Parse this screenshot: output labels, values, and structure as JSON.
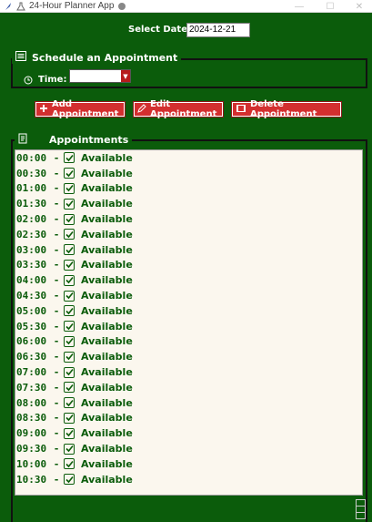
{
  "window": {
    "title": "24-Hour Planner App"
  },
  "date": {
    "label": "Select Date:",
    "value": "2024-12-21"
  },
  "schedule": {
    "title": "Schedule an Appointment",
    "time_label": "Time:",
    "time_value": ""
  },
  "buttons": {
    "add": "Add Appointment",
    "edit": "Edit Appointment",
    "delete": "Delete Appointment"
  },
  "appointments": {
    "title": "Appointments",
    "rows": [
      {
        "time": "00:00",
        "sep": "-",
        "status": "Available"
      },
      {
        "time": "00:30",
        "sep": "-",
        "status": "Available"
      },
      {
        "time": "01:00",
        "sep": "-",
        "status": "Available"
      },
      {
        "time": "01:30",
        "sep": "-",
        "status": "Available"
      },
      {
        "time": "02:00",
        "sep": "-",
        "status": "Available"
      },
      {
        "time": "02:30",
        "sep": "-",
        "status": "Available"
      },
      {
        "time": "03:00",
        "sep": "-",
        "status": "Available"
      },
      {
        "time": "03:30",
        "sep": "-",
        "status": "Available"
      },
      {
        "time": "04:00",
        "sep": "-",
        "status": "Available"
      },
      {
        "time": "04:30",
        "sep": "-",
        "status": "Available"
      },
      {
        "time": "05:00",
        "sep": "-",
        "status": "Available"
      },
      {
        "time": "05:30",
        "sep": "-",
        "status": "Available"
      },
      {
        "time": "06:00",
        "sep": "-",
        "status": "Available"
      },
      {
        "time": "06:30",
        "sep": "-",
        "status": "Available"
      },
      {
        "time": "07:00",
        "sep": "-",
        "status": "Available"
      },
      {
        "time": "07:30",
        "sep": "-",
        "status": "Available"
      },
      {
        "time": "08:00",
        "sep": "-",
        "status": "Available"
      },
      {
        "time": "08:30",
        "sep": "-",
        "status": "Available"
      },
      {
        "time": "09:00",
        "sep": "-",
        "status": "Available"
      },
      {
        "time": "09:30",
        "sep": "-",
        "status": "Available"
      },
      {
        "time": "10:00",
        "sep": "-",
        "status": "Available"
      },
      {
        "time": "10:30",
        "sep": "-",
        "status": "Available"
      }
    ]
  },
  "colors": {
    "background": "#0b5c0b",
    "button": "#d32f2f",
    "list_bg": "#fbf7ee",
    "text": "#0b5c0b"
  }
}
